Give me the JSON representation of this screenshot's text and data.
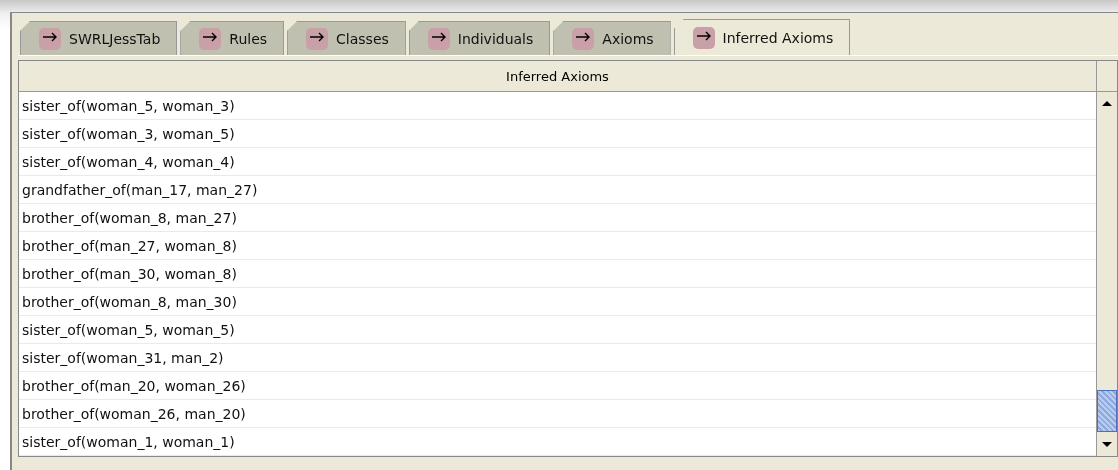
{
  "tabs": [
    {
      "label": "SWRLJessTab",
      "selected": false
    },
    {
      "label": "Rules",
      "selected": false
    },
    {
      "label": "Classes",
      "selected": false
    },
    {
      "label": "Individuals",
      "selected": false
    },
    {
      "label": "Axioms",
      "selected": false
    },
    {
      "label": "Inferred Axioms",
      "selected": true
    }
  ],
  "table": {
    "columns": [
      "Inferred Axioms"
    ],
    "rows": [
      "sister_of(woman_5, woman_3)",
      "sister_of(woman_3, woman_5)",
      "sister_of(woman_4, woman_4)",
      "grandfather_of(man_17, man_27)",
      "brother_of(woman_8, man_27)",
      "brother_of(man_27, woman_8)",
      "brother_of(man_30, woman_8)",
      "brother_of(woman_8, man_30)",
      "sister_of(woman_5, woman_5)",
      "sister_of(woman_31, man_2)",
      "brother_of(man_20, woman_26)",
      "brother_of(woman_26, man_20)",
      "sister_of(woman_1, woman_1)"
    ]
  }
}
